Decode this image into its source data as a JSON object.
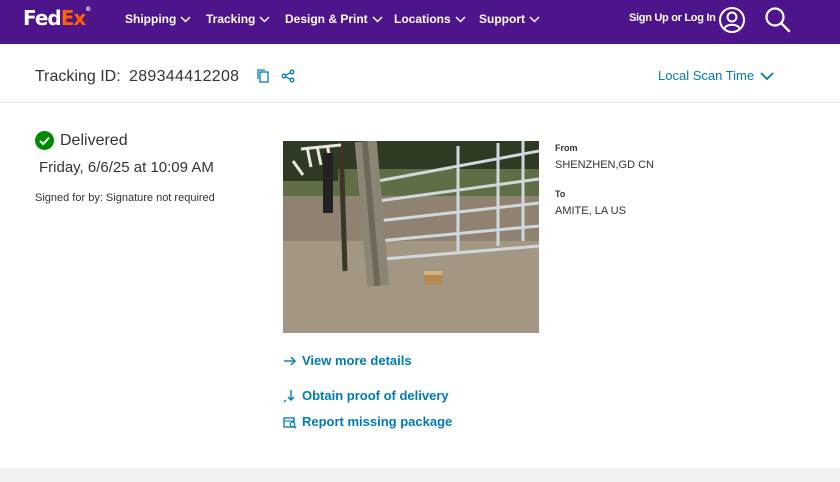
{
  "brand": {
    "logo_fed": "Fed",
    "logo_ex": "Ex",
    "logo_mark": "®",
    "primary": "#4d148c",
    "accent": "#ff6200",
    "link": "#007ab7"
  },
  "nav": {
    "items": [
      {
        "label": "Shipping"
      },
      {
        "label": "Tracking"
      },
      {
        "label": "Design & Print"
      },
      {
        "label": "Locations"
      },
      {
        "label": "Support"
      }
    ],
    "signin_label": "Sign Up or Log In"
  },
  "tracking": {
    "id_label": "Tracking ID:",
    "id_value": "289344412208",
    "scan_time_label": "Local Scan Time"
  },
  "status": {
    "text": "Delivered",
    "date": "Friday, 6/6/25 at 10:09 AM",
    "signed_for": "Signed for by: Signature not required"
  },
  "route": {
    "from_label": "From",
    "from_value": "SHENZHEN,GD CN",
    "to_label": "To",
    "to_value": "AMITE, LA US"
  },
  "links": {
    "view_details": "View more details",
    "proof": "Obtain proof of delivery",
    "missing": "Report missing package"
  }
}
